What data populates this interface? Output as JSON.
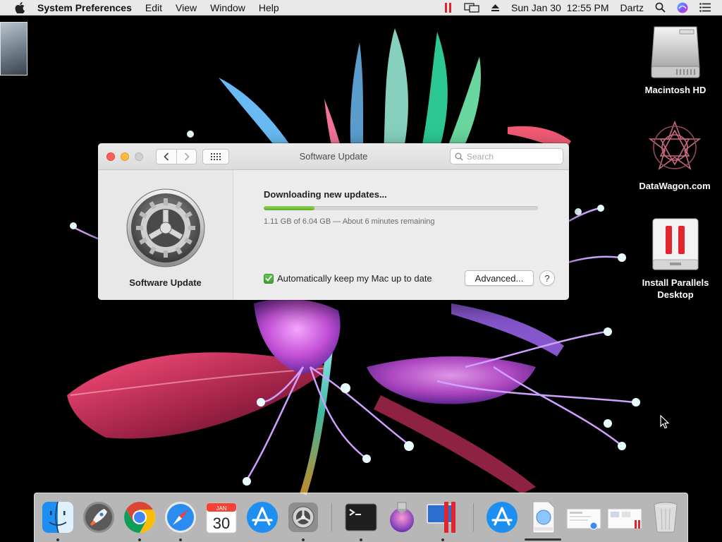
{
  "menubar": {
    "app_name": "System Preferences",
    "menus": [
      "Edit",
      "View",
      "Window",
      "Help"
    ],
    "clock": "Sun Jan 30  12:55 PM",
    "user": "Dartz"
  },
  "desktop": {
    "icons": [
      {
        "label": "Macintosh HD",
        "icon": "hard-drive-icon"
      },
      {
        "label": "DataWagon.com",
        "icon": "datawagon-logo-icon"
      },
      {
        "label": "Install Parallels Desktop",
        "icon": "parallels-installer-icon"
      }
    ]
  },
  "window": {
    "title": "Software Update",
    "search_placeholder": "Search",
    "pane_name": "Software Update",
    "status_title": "Downloading new updates...",
    "progress_fraction": 0.184,
    "progress_text": "1.11 GB of 6.04 GB — About 6 minutes remaining",
    "auto_update_label": "Automatically keep my Mac up to date",
    "auto_update_checked": true,
    "advanced_label": "Advanced...",
    "help_label": "?"
  },
  "dock": {
    "calendar_month": "JAN",
    "calendar_day": "30",
    "items": [
      "finder",
      "launchpad",
      "chrome",
      "safari",
      "calendar",
      "app-store",
      "system-preferences",
      "terminal",
      "installer",
      "parallels",
      "app-store-download",
      "downloads",
      "document-1",
      "document-2",
      "trash"
    ]
  },
  "colors": {
    "accent_green": "#62ad2a",
    "close": "#fc605b",
    "minimize": "#fdbc40",
    "menubar_bg": "#e9e9e9"
  }
}
